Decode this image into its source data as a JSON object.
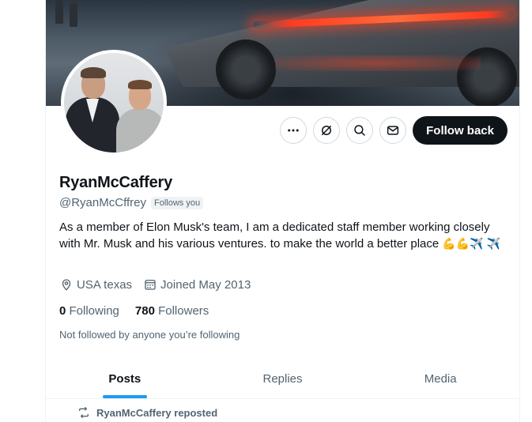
{
  "profile": {
    "display_name": "RyanMcCaffery",
    "handle": "@RyanMcCffrey",
    "follows_you_badge": "Follows you",
    "bio_text": "As a member of Elon Musk's team, I am a dedicated staff member working closely with Mr. Musk and his various ventures. to make the world a better place",
    "bio_emojis": [
      "💪",
      "💪",
      "✈️",
      "✈️"
    ],
    "location": "USA texas",
    "joined": "Joined May 2013",
    "following_count": "0",
    "following_label": "Following",
    "followers_count": "780",
    "followers_label": "Followers",
    "mutuals_note": "Not followed by anyone you’re following"
  },
  "actions": {
    "more_icon": "more-horizontal-icon",
    "grok_icon": "grok-icon",
    "search_icon": "search-icon",
    "message_icon": "envelope-icon",
    "follow_label": "Follow back"
  },
  "tabs": [
    {
      "label": "Posts",
      "active": true
    },
    {
      "label": "Replies",
      "active": false
    },
    {
      "label": "Media",
      "active": false
    }
  ],
  "feed": {
    "repost_text": "RyanMcCaffery reposted"
  },
  "colors": {
    "accent": "#1d9bf0",
    "text_primary": "#0f1419",
    "text_secondary": "#536471",
    "follow_button_bg": "#0f1419"
  }
}
